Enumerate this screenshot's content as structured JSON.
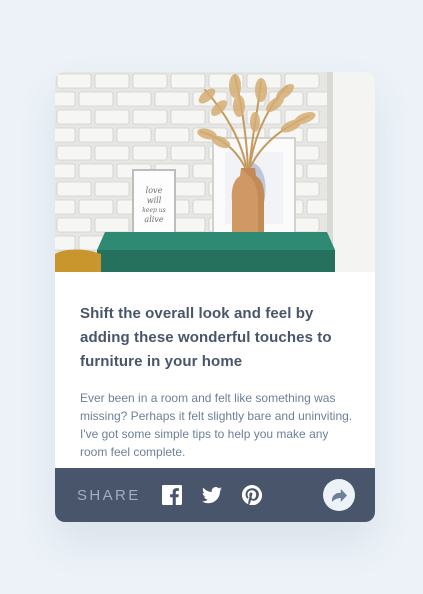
{
  "article": {
    "title": "Shift the overall look and feel by adding these wonderful touches to furniture in your home",
    "excerpt": "Ever been in a room and felt like something was missing? Perhaps it felt slightly bare and uninviting. I've got some simple tips to help you make any room feel complete."
  },
  "share": {
    "label": "SHARE",
    "networks": [
      "facebook-icon",
      "twitter-icon",
      "pinterest-icon"
    ],
    "button_icon": "share-arrow-icon"
  },
  "hero_image": {
    "frame_text": [
      "love",
      "will",
      "keep us",
      "alive"
    ]
  },
  "colors": {
    "background": "#ecf2f8",
    "dark_blue": "#48556a",
    "text_grey": "#6e8098",
    "share_label": "#9eafc2",
    "card": "#ffffff"
  }
}
